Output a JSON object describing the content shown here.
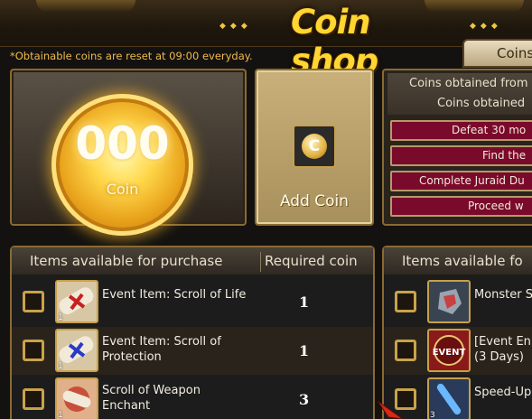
{
  "header": {
    "title": "Coin shop",
    "right_tab": "Coins"
  },
  "notice": "*Obtainable coins are reset at 09:00 everyday.",
  "coin_counter": {
    "count": "000",
    "label": "Coin"
  },
  "add_coin": {
    "label": "Add Coin",
    "icon": "coin-icon"
  },
  "info": {
    "line1": "Coins obtained from",
    "line2": "Coins obtained",
    "missions": [
      "Defeat 30 mo",
      "Find the",
      "Complete Juraid Du",
      "Proceed w"
    ]
  },
  "left_panel": {
    "header_items": "Items available for purchase",
    "header_coin": "Required coin",
    "rows": [
      {
        "name": "Event Item: Scroll of Life",
        "price": "1",
        "qty": "1",
        "icon": "scroll-icon"
      },
      {
        "name": "Event Item: Scroll of Protection",
        "price": "1",
        "qty": "1",
        "icon": "scroll-icon"
      },
      {
        "name": "Scroll of Weapon Enchant",
        "price": "3",
        "qty": "1",
        "icon": "scroll-icon"
      }
    ]
  },
  "right_panel": {
    "header_items": "Items available fo",
    "rows": [
      {
        "name": "Monster S",
        "qty": "",
        "icon": "monster-stone-icon"
      },
      {
        "name": "[Event En (3 Days)",
        "line1": "[Event En",
        "line2": "(3 Days)",
        "qty": "",
        "icon": "event-icon"
      },
      {
        "name": "Speed-Up",
        "qty": "3",
        "icon": "speed-potion-icon"
      }
    ]
  },
  "colors": {
    "gold": "#ffd632",
    "panel_border": "#8a6a32",
    "mission_bg": "#7a0a2c",
    "notice": "#f0ba4a"
  }
}
